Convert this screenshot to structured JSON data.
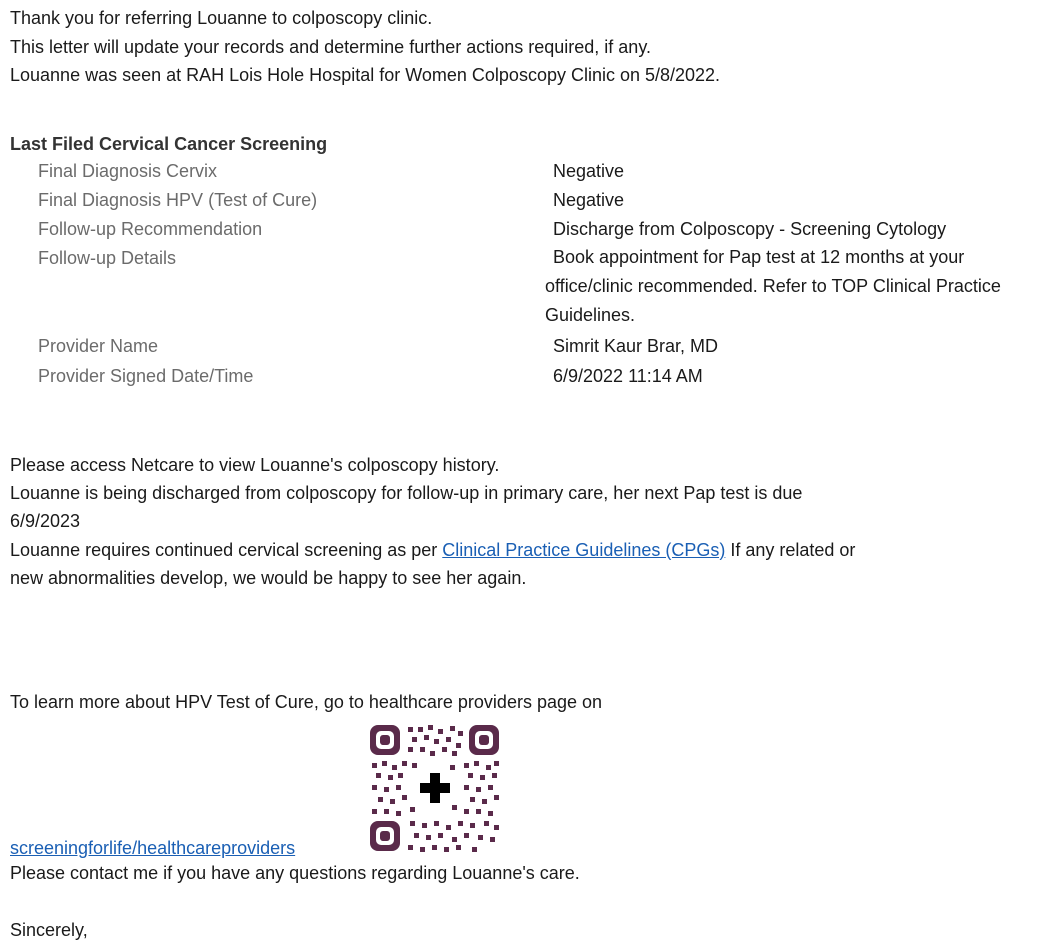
{
  "intro": {
    "line1": "Thank you for referring Louanne to colposcopy clinic.",
    "line2": "This letter will update your records and determine further actions required, if any.",
    "line3": "Louanne was seen at RAH Lois Hole Hospital for Women Colposcopy Clinic on 5/8/2022."
  },
  "screening": {
    "heading": "Last Filed Cervical Cancer Screening",
    "rows": [
      {
        "label": "Final Diagnosis Cervix",
        "value": "Negative"
      },
      {
        "label": "Final Diagnosis HPV (Test of Cure)",
        "value": "Negative"
      },
      {
        "label": "Follow-up Recommendation",
        "value": "Discharge from Colposcopy - Screening Cytology"
      },
      {
        "label": "Follow-up Details",
        "value": "Book appointment for Pap test at 12 months at your office/clinic recommended. Refer to TOP Clinical Practice Guidelines."
      },
      {
        "label": "Provider Name",
        "value": "Simrit Kaur Brar, MD"
      },
      {
        "label": "Provider Signed Date/Time",
        "value": "6/9/2022 11:14 AM"
      }
    ]
  },
  "body": {
    "netcare": "Please access Netcare to view Louanne's colposcopy history.",
    "discharge_line1": "Louanne is being discharged from colposcopy for follow-up in primary care, her next Pap test is due",
    "discharge_line2": "6/9/2023",
    "cpg_prefix": "Louanne requires continued cervical screening as per ",
    "cpg_link": "Clinical Practice Guidelines (CPGs)",
    "cpg_suffix": " If any related or",
    "cpg_line2": "new abnormalities develop, we would be happy to see her again.",
    "learn_more": "To learn more about HPV Test of Cure, go to healthcare providers page on",
    "screening_link": "screeningforlife/healthcareproviders",
    "contact": "Please contact me if you have any questions regarding Louanne's care.",
    "closing": "Sincerely,"
  },
  "colors": {
    "qr": "#5a2a4a",
    "link": "#1a5fb4",
    "label": "#6b6b6b"
  }
}
